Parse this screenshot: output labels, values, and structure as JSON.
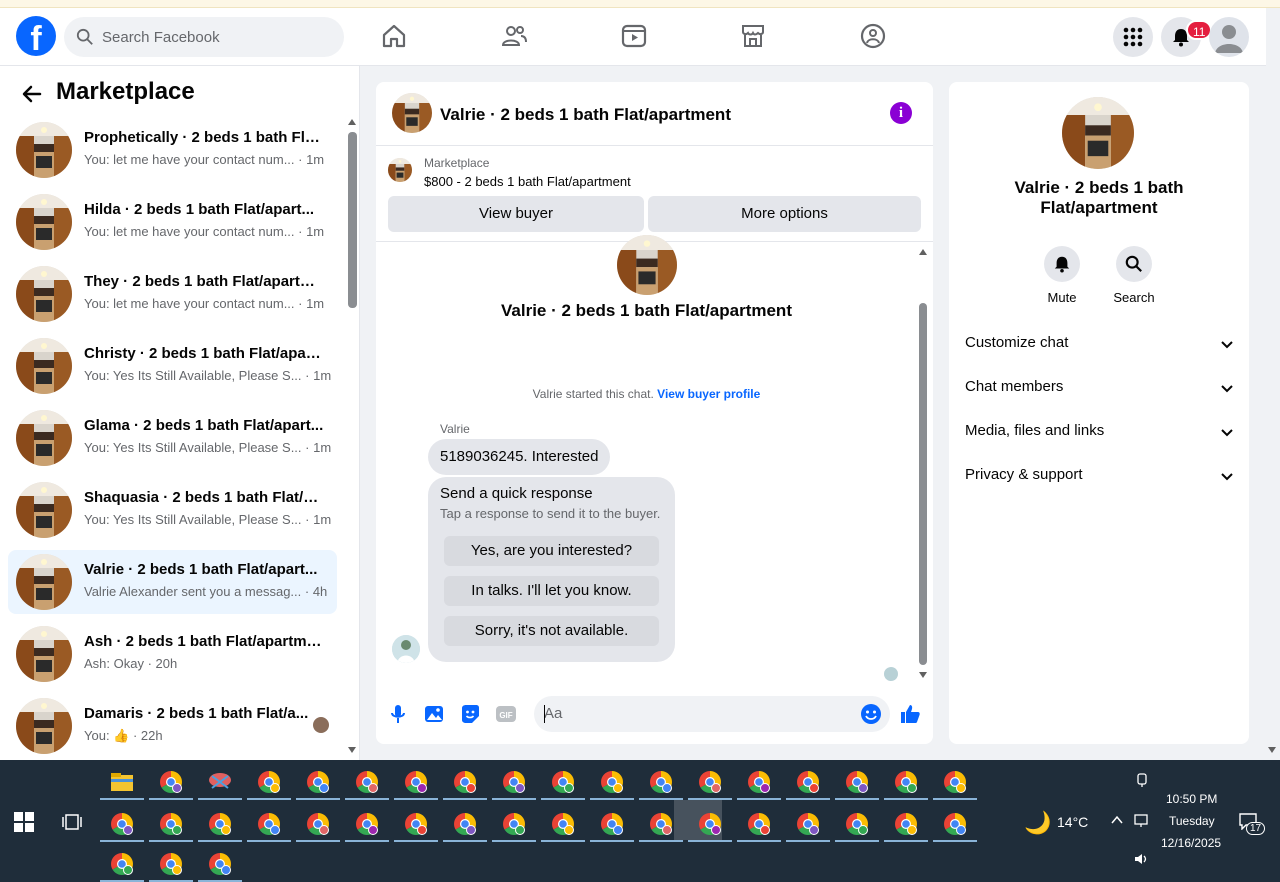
{
  "topbar": {
    "logo": "f",
    "search_placeholder": "Search Facebook",
    "notifications_badge": "11"
  },
  "sidebar": {
    "title": "Marketplace",
    "conversations": [
      {
        "name": "Prophetically · 2 beds 1 bath Flat...",
        "preview": "You: let me have your contact num... · 1m"
      },
      {
        "name": "Hilda · 2 beds 1 bath Flat/apart...",
        "preview": "You: let me have your contact num... · 1m"
      },
      {
        "name": "They · 2 beds 1 bath Flat/apartm...",
        "preview": "You: let me have your contact num... · 1m"
      },
      {
        "name": "Christy · 2 beds 1 bath Flat/apart...",
        "preview": "You: Yes Its Still Available, Please S... · 1m"
      },
      {
        "name": "Glama · 2 beds 1 bath Flat/apart...",
        "preview": "You: Yes Its Still Available, Please S... · 1m"
      },
      {
        "name": "Shaquasia · 2 beds 1 bath Flat/a...",
        "preview": "You: Yes Its Still Available, Please S... · 1m"
      },
      {
        "name": "Valrie · 2 beds 1 bath Flat/apart...",
        "preview": "Valrie Alexander sent you a messag... · 4h"
      },
      {
        "name": "Ash · 2 beds 1 bath Flat/apartme...",
        "preview": "Ash: Okay · 20h"
      },
      {
        "name": "Damaris · 2 beds 1 bath Flat/a...",
        "preview": "You: 👍 · 22h"
      }
    ]
  },
  "chat": {
    "header_title": "Valrie · 2 beds 1 bath Flat/apartment",
    "listing_label": "Marketplace",
    "listing_price": "$800 - 2 beds 1 bath Flat/apartment",
    "view_buyer": "View buyer",
    "more_options": "More options",
    "intro_title": "Valrie · 2 beds 1 bath Flat/apartment",
    "started_text": "Valrie started this chat.",
    "view_profile": "View buyer profile",
    "sender": "Valrie",
    "message": "5189036245.  Interested",
    "quick_title": "Send a quick response",
    "quick_sub": "Tap a response to send it to the buyer.",
    "quick_options": [
      "Yes, are you interested?",
      "In talks. I'll let you know.",
      "Sorry, it's not available."
    ],
    "composer_placeholder": "Aa"
  },
  "details": {
    "title": "Valrie · 2 beds 1 bath Flat/apartment",
    "mute": "Mute",
    "search": "Search",
    "sections": [
      "Customize chat",
      "Chat members",
      "Media, files and links",
      "Privacy & support"
    ]
  },
  "taskbar": {
    "weather": "14°C",
    "time": "10:50 PM",
    "day": "Tuesday",
    "date": "12/16/2025",
    "notif_count": "17"
  }
}
